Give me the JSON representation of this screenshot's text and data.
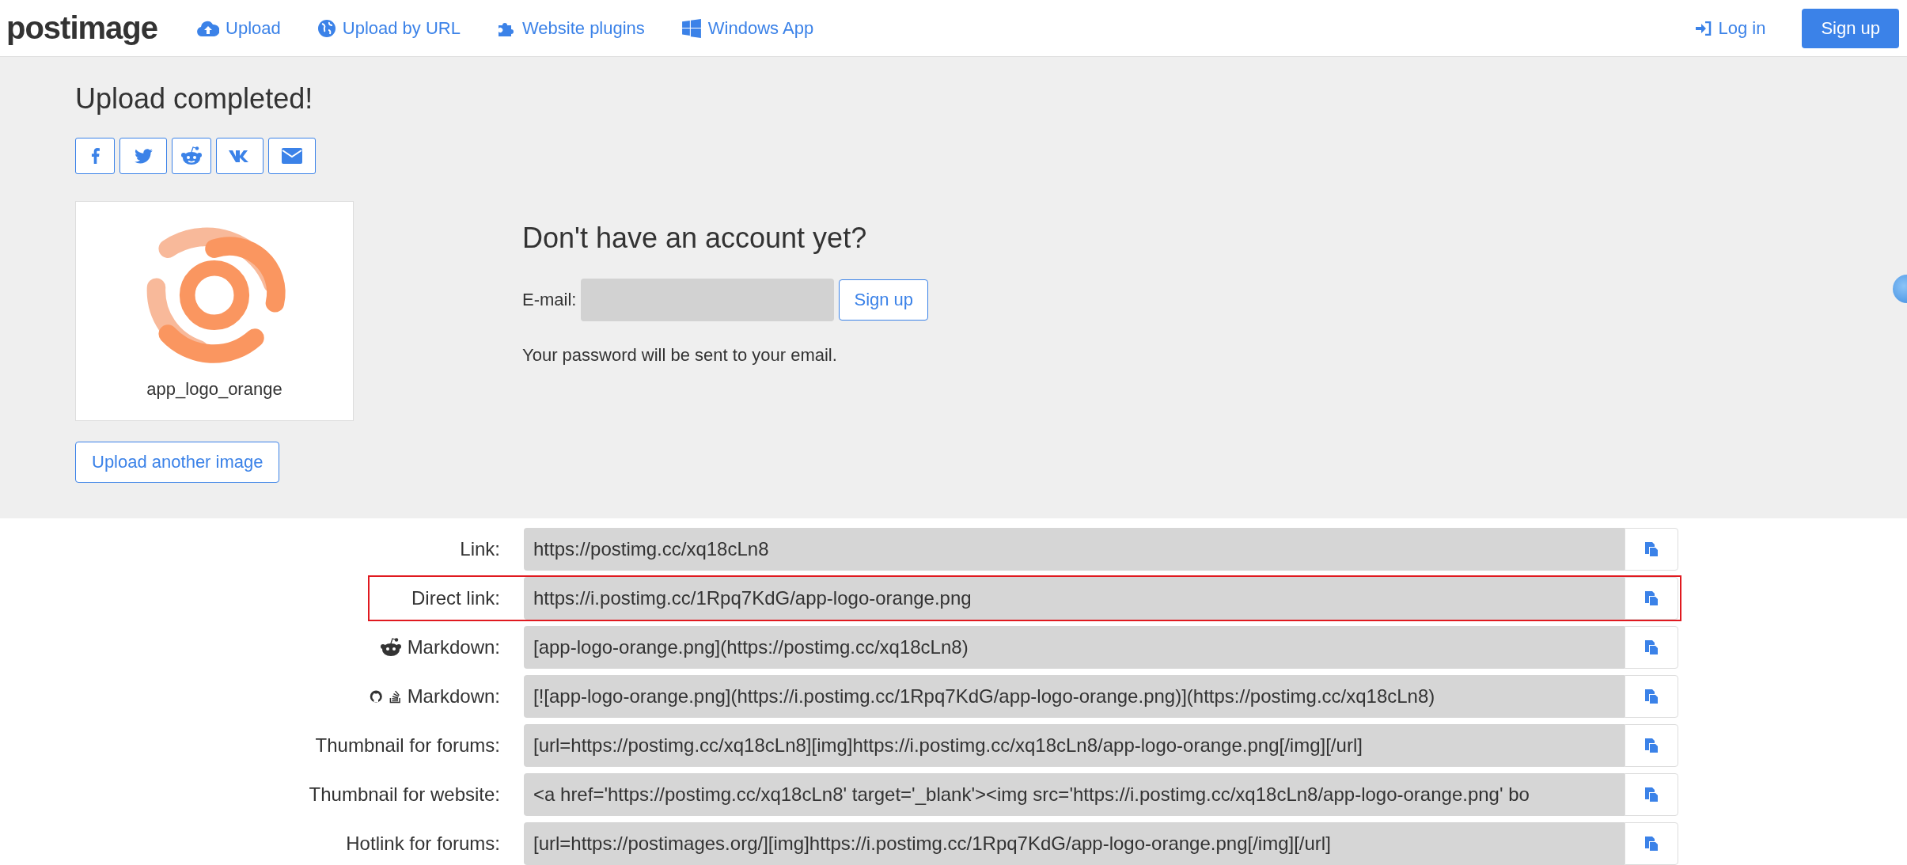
{
  "nav": {
    "logo": "postimage",
    "links": [
      {
        "kind": "upload",
        "label": "Upload"
      },
      {
        "kind": "globe",
        "label": "Upload by URL"
      },
      {
        "kind": "puzzle",
        "label": "Website plugins"
      },
      {
        "kind": "windows",
        "label": "Windows App"
      }
    ],
    "login": "Log in",
    "signup": "Sign up"
  },
  "upload": {
    "title": "Upload completed!",
    "share": [
      {
        "kind": "facebook"
      },
      {
        "kind": "twitter"
      },
      {
        "kind": "reddit"
      },
      {
        "kind": "vk"
      },
      {
        "kind": "email"
      }
    ],
    "image_caption": "app_logo_orange",
    "upload_another": "Upload another image"
  },
  "account": {
    "title": "Don't have an account yet?",
    "email_label": "E-mail:",
    "signup": "Sign up",
    "note": "Your password will be sent to your email."
  },
  "links": [
    {
      "kind": "plain",
      "label": "Link:",
      "value": "https://postimg.cc/xq18cLn8",
      "highlighted": false
    },
    {
      "kind": "plain",
      "label": "Direct link:",
      "value": "https://i.postimg.cc/1Rpq7KdG/app-logo-orange.png",
      "highlighted": true
    },
    {
      "kind": "reddit",
      "label": "Markdown:",
      "value": "[app-logo-orange.png](https://postimg.cc/xq18cLn8)",
      "highlighted": false
    },
    {
      "kind": "github",
      "label": "Markdown:",
      "value": "[![app-logo-orange.png](https://i.postimg.cc/1Rpq7KdG/app-logo-orange.png)](https://postimg.cc/xq18cLn8)",
      "highlighted": false
    },
    {
      "kind": "plain",
      "label": "Thumbnail for forums:",
      "value": "[url=https://postimg.cc/xq18cLn8][img]https://i.postimg.cc/xq18cLn8/app-logo-orange.png[/img][/url]",
      "highlighted": false
    },
    {
      "kind": "plain",
      "label": "Thumbnail for website:",
      "value": "<a href='https://postimg.cc/xq18cLn8' target='_blank'><img src='https://i.postimg.cc/xq18cLn8/app-logo-orange.png' bo",
      "highlighted": false
    },
    {
      "kind": "plain",
      "label": "Hotlink for forums:",
      "value": "[url=https://postimages.org/][img]https://i.postimg.cc/1Rpq7KdG/app-logo-orange.png[/img][/url]",
      "highlighted": false
    }
  ]
}
